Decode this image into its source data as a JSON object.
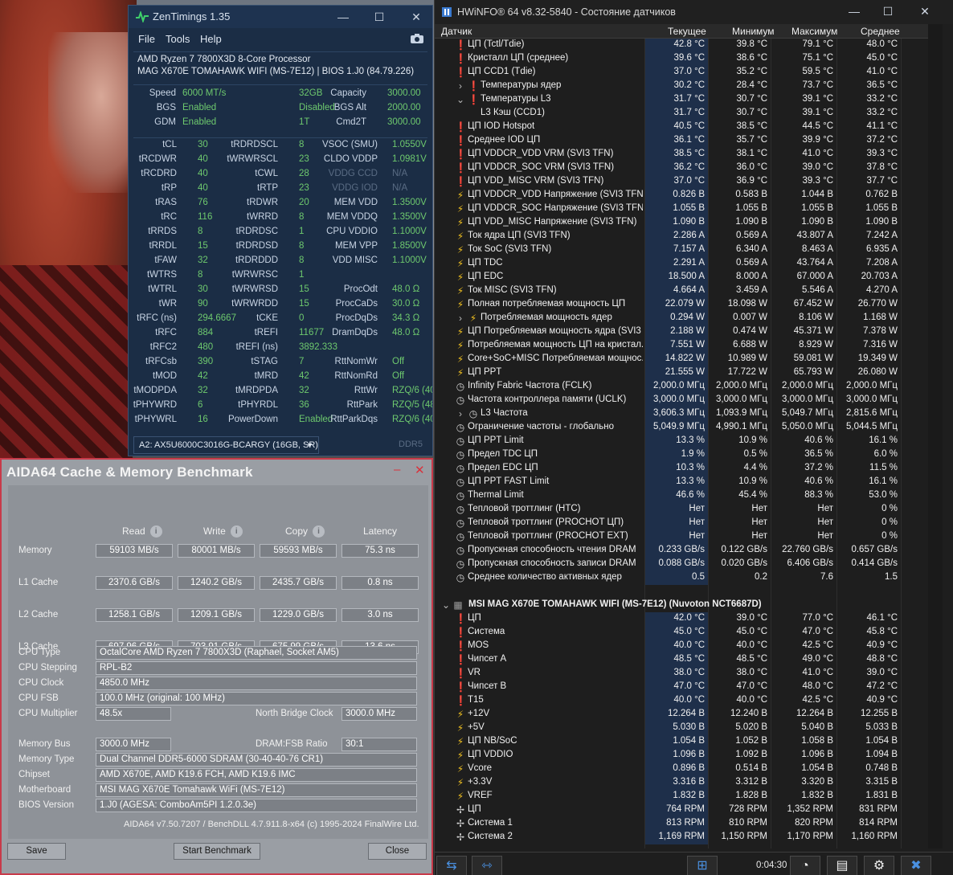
{
  "zen": {
    "title": "ZenTimings 1.35",
    "menu": [
      "File",
      "Tools",
      "Help"
    ],
    "cpu": "AMD Ryzen 7 7800X3D 8-Core Processor",
    "board": "MAG X670E TOMAHAWK WIFI (MS-7E12) | BIOS 1.J0 (84.79.226)",
    "top": [
      [
        "Speed",
        "6000 MT/s",
        "Capacity",
        "32GB",
        "MCLK",
        "3000.00"
      ],
      [
        "BGS",
        "Enabled",
        "BGS Alt",
        "Disabled",
        "FCLK",
        "2000.00"
      ],
      [
        "GDM",
        "Enabled",
        "Cmd2T",
        "1T",
        "UCLK",
        "3000.00"
      ]
    ],
    "timings": [
      [
        "tCL",
        "30",
        "tRDRDSCL",
        "8",
        "VSOC (SMU)",
        "1.0550V"
      ],
      [
        "tRCDWR",
        "40",
        "tWRWRSCL",
        "23",
        "CLDO VDDP",
        "1.0981V"
      ],
      [
        "tRCDRD",
        "40",
        "tCWL",
        "28",
        "VDDG CCD",
        "N/A"
      ],
      [
        "tRP",
        "40",
        "tRTP",
        "23",
        "VDDG IOD",
        "N/A"
      ],
      [
        "tRAS",
        "76",
        "tRDWR",
        "20",
        "MEM VDD",
        "1.3500V"
      ],
      [
        "tRC",
        "116",
        "tWRRD",
        "8",
        "MEM VDDQ",
        "1.3500V"
      ],
      [
        "tRRDS",
        "8",
        "tRDRDSC",
        "1",
        "CPU VDDIO",
        "1.1000V"
      ],
      [
        "tRRDL",
        "15",
        "tRDRDSD",
        "8",
        "MEM VPP",
        "1.8500V"
      ],
      [
        "tFAW",
        "32",
        "tRDRDDD",
        "8",
        "VDD MISC",
        "1.1000V"
      ],
      [
        "tWTRS",
        "8",
        "tWRWRSC",
        "1",
        "",
        ""
      ],
      [
        "tWTRL",
        "30",
        "tWRWRSD",
        "15",
        "ProcOdt",
        "48.0 Ω"
      ],
      [
        "tWR",
        "90",
        "tWRWRDD",
        "15",
        "ProcCaDs",
        "30.0 Ω"
      ],
      [
        "tRFC (ns)",
        "294.6667",
        "tCKE",
        "0",
        "ProcDqDs",
        "34.3 Ω"
      ],
      [
        "tRFC",
        "884",
        "tREFI",
        "11677",
        "DramDqDs",
        "48.0 Ω"
      ],
      [
        "tRFC2",
        "480",
        "tREFI (ns)",
        "3892.333",
        "",
        ""
      ],
      [
        "tRFCsb",
        "390",
        "tSTAG",
        "7",
        "RttNomWr",
        "Off"
      ],
      [
        "tMOD",
        "42",
        "tMRD",
        "42",
        "RttNomRd",
        "Off"
      ],
      [
        "tMODPDA",
        "32",
        "tMRDPDA",
        "32",
        "RttWr",
        "RZQ/6 (40)"
      ],
      [
        "tPHYWRD",
        "6",
        "tPHYRDL",
        "36",
        "RttPark",
        "RZQ/5 (48)"
      ],
      [
        "tPHYWRL",
        "16",
        "PowerDown",
        "Enabled",
        "RttParkDqs",
        "RZQ/6 (40)"
      ]
    ],
    "dimm": "A2: AX5U6000C3016G-BCARGY (16GB, SR)",
    "ddr": "DDR5"
  },
  "aida": {
    "title": "AIDA64 Cache & Memory Benchmark",
    "headers": [
      "Read",
      "Write",
      "Copy",
      "Latency"
    ],
    "bench": [
      {
        "label": "Memory",
        "vals": [
          "59103 MB/s",
          "80001 MB/s",
          "59593 MB/s",
          "75.3 ns"
        ]
      },
      {
        "label": "L1 Cache",
        "vals": [
          "2370.6 GB/s",
          "1240.2 GB/s",
          "2435.7 GB/s",
          "0.8 ns"
        ]
      },
      {
        "label": "L2 Cache",
        "vals": [
          "1258.1 GB/s",
          "1209.1 GB/s",
          "1229.0 GB/s",
          "3.0 ns"
        ]
      },
      {
        "label": "L3 Cache",
        "vals": [
          "697.96 GB/s",
          "703.91 GB/s",
          "675.99 GB/s",
          "13.6 ns"
        ]
      }
    ],
    "cpu_type_label": "CPU Type",
    "cpu_type": "OctalCore AMD Ryzen 7 7800X3D  (Raphael, Socket AM5)",
    "cpu_stepping_label": "CPU Stepping",
    "cpu_stepping": "RPL-B2",
    "cpu_clock_label": "CPU Clock",
    "cpu_clock": "4850.0 MHz",
    "cpu_fsb_label": "CPU FSB",
    "cpu_fsb": "100.0 MHz  (original: 100 MHz)",
    "cpu_mult_label": "CPU Multiplier",
    "cpu_mult": "48.5x",
    "nb_clock_label": "North Bridge Clock",
    "nb_clock": "3000.0 MHz",
    "mem_bus_label": "Memory Bus",
    "mem_bus": "3000.0 MHz",
    "dram_ratio_label": "DRAM:FSB Ratio",
    "dram_ratio": "30:1",
    "mem_type_label": "Memory Type",
    "mem_type": "Dual Channel DDR5-6000 SDRAM  (30-40-40-76 CR1)",
    "chipset_label": "Chipset",
    "chipset": "AMD X670E, AMD K19.6 FCH, AMD K19.6 IMC",
    "motherboard_label": "Motherboard",
    "motherboard": "MSI MAG X670E Tomahawk WiFi (MS-7E12)",
    "bios_label": "BIOS Version",
    "bios": "1.J0  (AGESA: ComboAm5PI 1.2.0.3e)",
    "footer": "AIDA64 v7.50.7207 / BenchDLL 4.7.911.8-x64  (c) 1995-2024 FinalWire Ltd.",
    "save": "Save",
    "start": "Start Benchmark",
    "close": "Close"
  },
  "hw": {
    "title": "HWiNFO® 64 v8.32-5840 - Состояние датчиков",
    "columns": [
      "Датчик",
      "Текущее",
      "Минимум",
      "Максимум",
      "Среднее"
    ],
    "rows": [
      {
        "icon": "temp-icon",
        "name": "ЦП (Tctl/Tdie)",
        "v": [
          "42.8 °C",
          "39.8 °C",
          "79.1 °C",
          "48.0 °C"
        ]
      },
      {
        "icon": "temp-icon",
        "name": "Кристалл ЦП (среднее)",
        "v": [
          "39.6 °C",
          "38.6 °C",
          "75.1 °C",
          "45.0 °C"
        ]
      },
      {
        "icon": "temp-icon",
        "name": "ЦП CCD1 (Tdie)",
        "v": [
          "37.0 °C",
          "35.2 °C",
          "59.5 °C",
          "41.0 °C"
        ]
      },
      {
        "icon": "temp-icon",
        "name": "Температуры ядер",
        "v": [
          "30.2 °C",
          "28.4 °C",
          "73.7 °C",
          "36.5 °C"
        ],
        "indent": 1,
        "exp": "›"
      },
      {
        "icon": "temp-icon",
        "name": "Температуры L3",
        "v": [
          "31.7 °C",
          "30.7 °C",
          "39.1 °C",
          "33.2 °C"
        ],
        "indent": 1,
        "exp": "⌄"
      },
      {
        "icon": "",
        "name": "L3 Кэш (CCD1)",
        "v": [
          "31.7 °C",
          "30.7 °C",
          "39.1 °C",
          "33.2 °C"
        ],
        "indent": 1
      },
      {
        "icon": "temp-icon",
        "name": "ЦП IOD Hotspot",
        "v": [
          "40.5 °C",
          "38.5 °C",
          "44.5 °C",
          "41.1 °C"
        ]
      },
      {
        "icon": "temp-icon",
        "name": "Среднее IOD ЦП",
        "v": [
          "36.1 °C",
          "35.7 °C",
          "39.9 °C",
          "37.2 °C"
        ]
      },
      {
        "icon": "temp-icon",
        "name": "ЦП VDDCR_VDD VRM (SVI3 TFN)",
        "v": [
          "38.5 °C",
          "38.1 °C",
          "41.0 °C",
          "39.3 °C"
        ]
      },
      {
        "icon": "temp-icon",
        "name": "ЦП VDDCR_SOC VRM (SVI3 TFN)",
        "v": [
          "36.2 °C",
          "36.0 °C",
          "39.0 °C",
          "37.8 °C"
        ]
      },
      {
        "icon": "temp-icon",
        "name": "ЦП VDD_MISC VRM (SVI3 TFN)",
        "v": [
          "37.0 °C",
          "36.9 °C",
          "39.3 °C",
          "37.7 °C"
        ]
      },
      {
        "icon": "bolt-icon",
        "name": "ЦП VDDCR_VDD Напряжение (SVI3 TFN)",
        "v": [
          "0.826 В",
          "0.583 В",
          "1.044 В",
          "0.762 В"
        ]
      },
      {
        "icon": "bolt-icon",
        "name": "ЦП VDDCR_SOC Напряжение (SVI3 TFN)",
        "v": [
          "1.055 В",
          "1.055 В",
          "1.055 В",
          "1.055 В"
        ]
      },
      {
        "icon": "bolt-icon",
        "name": "ЦП VDD_MISC Напряжение (SVI3 TFN)",
        "v": [
          "1.090 В",
          "1.090 В",
          "1.090 В",
          "1.090 В"
        ]
      },
      {
        "icon": "bolt-icon",
        "name": "Ток ядра ЦП (SVI3 TFN)",
        "v": [
          "2.286 A",
          "0.569 A",
          "43.807 A",
          "7.242 A"
        ]
      },
      {
        "icon": "bolt-icon",
        "name": "Ток SoC (SVI3 TFN)",
        "v": [
          "7.157 A",
          "6.340 A",
          "8.463 A",
          "6.935 A"
        ]
      },
      {
        "icon": "bolt-icon",
        "name": "ЦП TDC",
        "v": [
          "2.291 A",
          "0.569 A",
          "43.764 A",
          "7.208 A"
        ]
      },
      {
        "icon": "bolt-icon",
        "name": "ЦП EDC",
        "v": [
          "18.500 A",
          "8.000 A",
          "67.000 A",
          "20.703 A"
        ]
      },
      {
        "icon": "bolt-icon",
        "name": "Ток MISC (SVI3 TFN)",
        "v": [
          "4.664 A",
          "3.459 A",
          "5.546 A",
          "4.270 A"
        ]
      },
      {
        "icon": "bolt-icon",
        "name": "Полная потребляемая мощность ЦП",
        "v": [
          "22.079 W",
          "18.098 W",
          "67.452 W",
          "26.770 W"
        ]
      },
      {
        "icon": "bolt-icon",
        "name": "Потребляемая мощность ядер",
        "v": [
          "0.294 W",
          "0.007 W",
          "8.106 W",
          "1.168 W"
        ],
        "indent": 1,
        "exp": "›"
      },
      {
        "icon": "bolt-icon",
        "name": "ЦП Потребляемая мощность ядра (SVI3 ...",
        "v": [
          "2.188 W",
          "0.474 W",
          "45.371 W",
          "7.378 W"
        ]
      },
      {
        "icon": "bolt-icon",
        "name": "Потребляемая мощность ЦП на кристал...",
        "v": [
          "7.551 W",
          "6.688 W",
          "8.929 W",
          "7.316 W"
        ]
      },
      {
        "icon": "bolt-icon",
        "name": "Core+SoC+MISC Потребляемая мощнос...",
        "v": [
          "14.822 W",
          "10.989 W",
          "59.081 W",
          "19.349 W"
        ]
      },
      {
        "icon": "bolt-icon",
        "name": "ЦП PPT",
        "v": [
          "21.555 W",
          "17.722 W",
          "65.793 W",
          "26.080 W"
        ]
      },
      {
        "icon": "clock-icon",
        "name": "Infinity Fabric Частота (FCLK)",
        "v": [
          "2,000.0 МГц",
          "2,000.0 МГц",
          "2,000.0 МГц",
          "2,000.0 МГц"
        ]
      },
      {
        "icon": "clock-icon",
        "name": "Частота контроллера памяти (UCLK)",
        "v": [
          "3,000.0 МГц",
          "3,000.0 МГц",
          "3,000.0 МГц",
          "3,000.0 МГц"
        ]
      },
      {
        "icon": "clock-icon",
        "name": "L3 Частота",
        "v": [
          "3,606.3 МГц",
          "1,093.9 МГц",
          "5,049.7 МГц",
          "2,815.6 МГц"
        ],
        "indent": 1,
        "exp": "›"
      },
      {
        "icon": "clock-icon",
        "name": "Ограничение частоты - глобально",
        "v": [
          "5,049.9 МГц",
          "4,990.1 МГц",
          "5,050.0 МГц",
          "5,044.5 МГц"
        ]
      },
      {
        "icon": "clock-icon",
        "name": "ЦП PPT Limit",
        "v": [
          "13.3 %",
          "10.9 %",
          "40.6 %",
          "16.1 %"
        ]
      },
      {
        "icon": "clock-icon",
        "name": "Предел TDC ЦП",
        "v": [
          "1.9 %",
          "0.5 %",
          "36.5 %",
          "6.0 %"
        ]
      },
      {
        "icon": "clock-icon",
        "name": "Предел EDC ЦП",
        "v": [
          "10.3 %",
          "4.4 %",
          "37.2 %",
          "11.5 %"
        ]
      },
      {
        "icon": "clock-icon",
        "name": "ЦП PPT FAST Limit",
        "v": [
          "13.3 %",
          "10.9 %",
          "40.6 %",
          "16.1 %"
        ]
      },
      {
        "icon": "clock-icon",
        "name": "Thermal Limit",
        "v": [
          "46.6 %",
          "45.4 %",
          "88.3 %",
          "53.0 %"
        ]
      },
      {
        "icon": "clock-icon",
        "name": "Тепловой троттлинг (HTC)",
        "v": [
          "Нет",
          "Нет",
          "Нет",
          "0 %"
        ]
      },
      {
        "icon": "clock-icon",
        "name": "Тепловой троттлинг (PROCHOT ЦП)",
        "v": [
          "Нет",
          "Нет",
          "Нет",
          "0 %"
        ]
      },
      {
        "icon": "clock-icon",
        "name": "Тепловой троттлинг (PROCHOT EXT)",
        "v": [
          "Нет",
          "Нет",
          "Нет",
          "0 %"
        ]
      },
      {
        "icon": "clock-icon",
        "name": "Пропускная способность чтения DRAM",
        "v": [
          "0.233 GB/s",
          "0.122 GB/s",
          "22.760 GB/s",
          "0.657 GB/s"
        ]
      },
      {
        "icon": "clock-icon",
        "name": "Пропускная способность записи DRAM",
        "v": [
          "0.088 GB/s",
          "0.020 GB/s",
          "6.406 GB/s",
          "0.414 GB/s"
        ]
      },
      {
        "icon": "clock-icon",
        "name": "Среднее количество активных ядер",
        "v": [
          "0.5",
          "0.2",
          "7.6",
          "1.5"
        ]
      },
      {
        "icon": "",
        "name": "",
        "v": [
          "",
          "",
          "",
          ""
        ],
        "blank": true
      },
      {
        "icon": "chip-icon",
        "name": "MSI MAG X670E TOMAHAWK WIFI (MS-7E12) (Nuvoton NCT6687D)",
        "v": [
          "",
          "",
          "",
          ""
        ],
        "group": true
      },
      {
        "icon": "temp-icon",
        "name": "ЦП",
        "v": [
          "42.0 °C",
          "39.0 °C",
          "77.0 °C",
          "46.1 °C"
        ]
      },
      {
        "icon": "temp-icon",
        "name": "Система",
        "v": [
          "45.0 °C",
          "45.0 °C",
          "47.0 °C",
          "45.8 °C"
        ]
      },
      {
        "icon": "temp-icon",
        "name": "MOS",
        "v": [
          "40.0 °C",
          "40.0 °C",
          "42.5 °C",
          "40.9 °C"
        ]
      },
      {
        "icon": "temp-icon",
        "name": "Чипсет A",
        "v": [
          "48.5 °C",
          "48.5 °C",
          "49.0 °C",
          "48.8 °C"
        ]
      },
      {
        "icon": "temp-icon",
        "name": "VR",
        "v": [
          "38.0 °C",
          "38.0 °C",
          "41.0 °C",
          "39.0 °C"
        ]
      },
      {
        "icon": "temp-icon",
        "name": "Чипсет B",
        "v": [
          "47.0 °C",
          "47.0 °C",
          "48.0 °C",
          "47.2 °C"
        ]
      },
      {
        "icon": "temp-icon",
        "name": "T15",
        "v": [
          "40.0 °C",
          "40.0 °C",
          "42.5 °C",
          "40.9 °C"
        ]
      },
      {
        "icon": "bolt-icon",
        "name": "+12V",
        "v": [
          "12.264 В",
          "12.240 В",
          "12.264 В",
          "12.255 В"
        ]
      },
      {
        "icon": "bolt-icon",
        "name": "+5V",
        "v": [
          "5.030 В",
          "5.020 В",
          "5.040 В",
          "5.033 В"
        ]
      },
      {
        "icon": "bolt-icon",
        "name": "ЦП NB/SoC",
        "v": [
          "1.054 В",
          "1.052 В",
          "1.058 В",
          "1.054 В"
        ]
      },
      {
        "icon": "bolt-icon",
        "name": "ЦП VDDIO",
        "v": [
          "1.096 В",
          "1.092 В",
          "1.096 В",
          "1.094 В"
        ]
      },
      {
        "icon": "bolt-icon",
        "name": "Vcore",
        "v": [
          "0.896 В",
          "0.514 В",
          "1.054 В",
          "0.748 В"
        ]
      },
      {
        "icon": "bolt-icon",
        "name": "+3.3V",
        "v": [
          "3.316 В",
          "3.312 В",
          "3.320 В",
          "3.315 В"
        ]
      },
      {
        "icon": "bolt-icon",
        "name": "VREF",
        "v": [
          "1.832 В",
          "1.828 В",
          "1.832 В",
          "1.831 В"
        ]
      },
      {
        "icon": "fan-icon",
        "name": "ЦП",
        "v": [
          "764 RPM",
          "728 RPM",
          "1,352 RPM",
          "831 RPM"
        ]
      },
      {
        "icon": "fan-icon",
        "name": "Система 1",
        "v": [
          "813 RPM",
          "810 RPM",
          "820 RPM",
          "814 RPM"
        ]
      },
      {
        "icon": "fan-icon",
        "name": "Система 2",
        "v": [
          "1,169 RPM",
          "1,150 RPM",
          "1,170 RPM",
          "1,160 RPM"
        ]
      }
    ],
    "timer": "0:04:30",
    "colors": {
      "temp": "#e03030",
      "bolt": "#f0c020",
      "clock": "#d0d0d0",
      "fan": "#d0d0d0"
    }
  }
}
